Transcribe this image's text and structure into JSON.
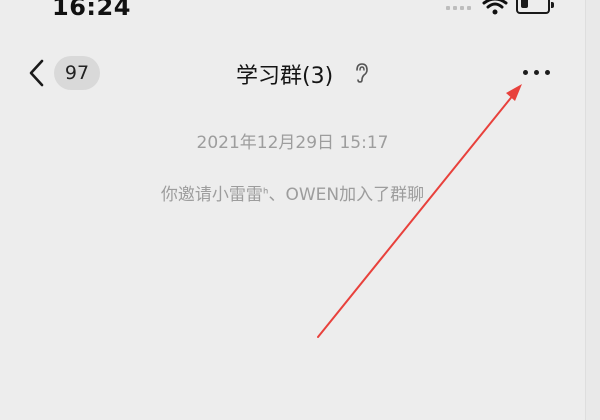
{
  "status_bar": {
    "time": "16:24",
    "icons": [
      "signal-icon",
      "wifi-icon",
      "battery-icon"
    ]
  },
  "nav": {
    "back_icon": "chevron-left-icon",
    "unread_count": "97",
    "title": "学习群(3)",
    "mute_icon": "ear-icon",
    "more_icon": "more-dots-icon"
  },
  "messages": {
    "timestamp": "2021年12月29日 15:17",
    "notice": "你邀请小雷雷ᑋ、OWEN加入了群聊"
  },
  "annotation": {
    "arrow_color": "#e8413c"
  },
  "colors": {
    "background": "#ededed",
    "badge": "#d9d9d9",
    "system_text": "#9d9d9d"
  }
}
